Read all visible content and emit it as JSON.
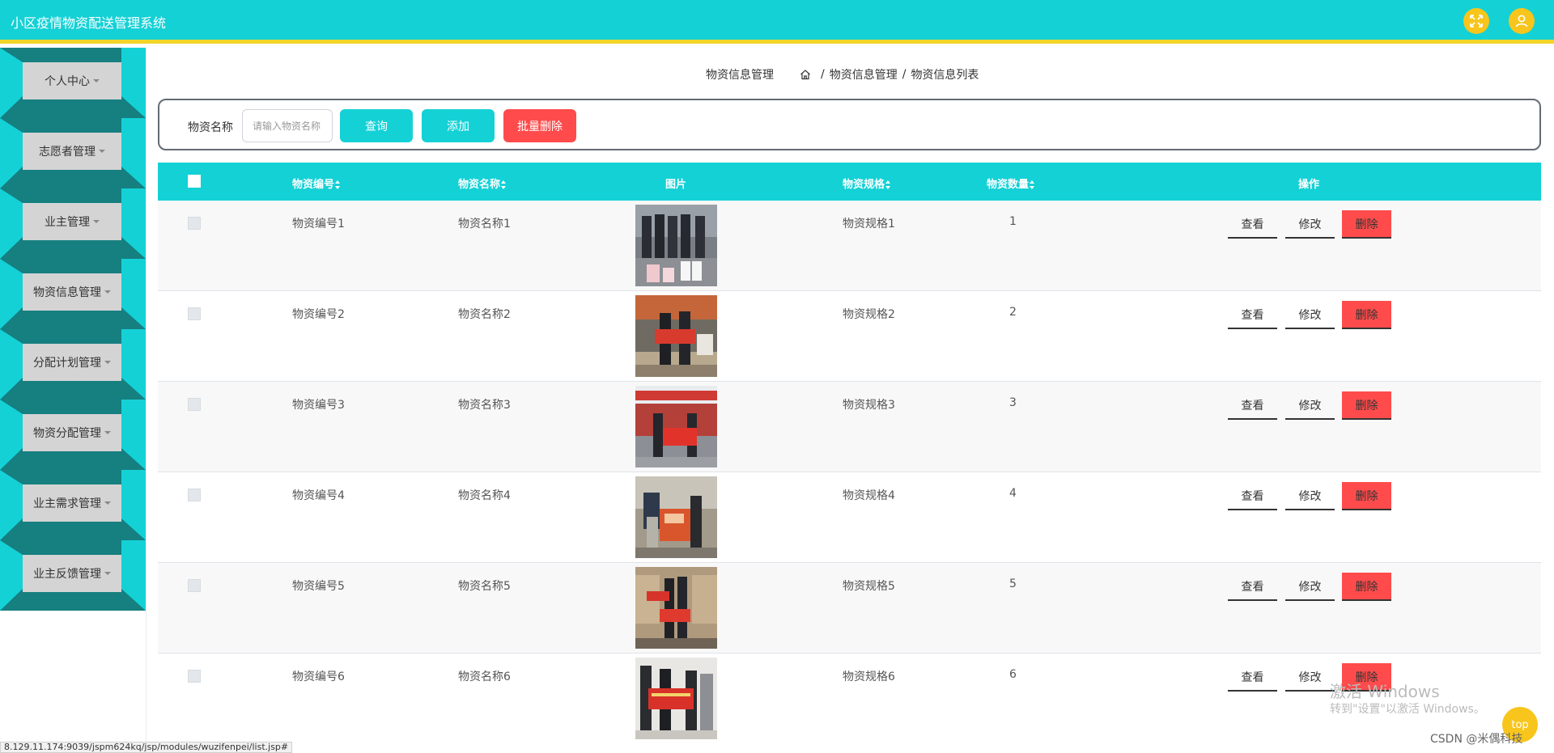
{
  "app": {
    "title": "小区疫情物资配送管理系统"
  },
  "header": {
    "fullscreen_icon": "fullscreen-icon",
    "user_icon": "user-icon",
    "colors": {
      "bar": "#14d1d6",
      "accent": "#f2d52a",
      "icon_bg": "#f7c51c"
    }
  },
  "sidebar": {
    "items": [
      {
        "label": "个人中心"
      },
      {
        "label": "志愿者管理"
      },
      {
        "label": "业主管理"
      },
      {
        "label": "物资信息管理"
      },
      {
        "label": "分配计划管理"
      },
      {
        "label": "物资分配管理"
      },
      {
        "label": "业主需求管理"
      },
      {
        "label": "业主反馈管理"
      }
    ]
  },
  "breadcrumb": {
    "section": "物资信息管理",
    "path": [
      "物资信息管理",
      "物资信息列表"
    ],
    "separator": "/"
  },
  "search": {
    "label": "物资名称",
    "placeholder": "请输入物资名称",
    "value": "",
    "query_label": "查询",
    "add_label": "添加",
    "batch_delete_label": "批量删除"
  },
  "table": {
    "columns": {
      "code": "物资编号",
      "name": "物资名称",
      "image": "图片",
      "spec": "物资规格",
      "qty": "物资数量",
      "ops": "操作"
    },
    "actions": {
      "view": "查看",
      "edit": "修改",
      "delete": "删除"
    },
    "rows": [
      {
        "code": "物资编号1",
        "name": "物资名称1",
        "spec": "物资规格1",
        "qty": "1"
      },
      {
        "code": "物资编号2",
        "name": "物资名称2",
        "spec": "物资规格2",
        "qty": "2"
      },
      {
        "code": "物资编号3",
        "name": "物资名称3",
        "spec": "物资规格3",
        "qty": "3"
      },
      {
        "code": "物资编号4",
        "name": "物资名称4",
        "spec": "物资规格4",
        "qty": "4"
      },
      {
        "code": "物资编号5",
        "name": "物资名称5",
        "spec": "物资规格5",
        "qty": "5"
      },
      {
        "code": "物资编号6",
        "name": "物资名称6",
        "spec": "物资规格6",
        "qty": "6"
      }
    ]
  },
  "overlay": {
    "watermark_line1": "激活 Windows",
    "watermark_line2": "转到\"设置\"以激活 Windows。",
    "csdn": "CSDN @米偶科技",
    "top_label": "top",
    "status_url": "8.129.11.174:9039/jspm624kq/jsp/modules/wuzifenpei/list.jsp#"
  }
}
